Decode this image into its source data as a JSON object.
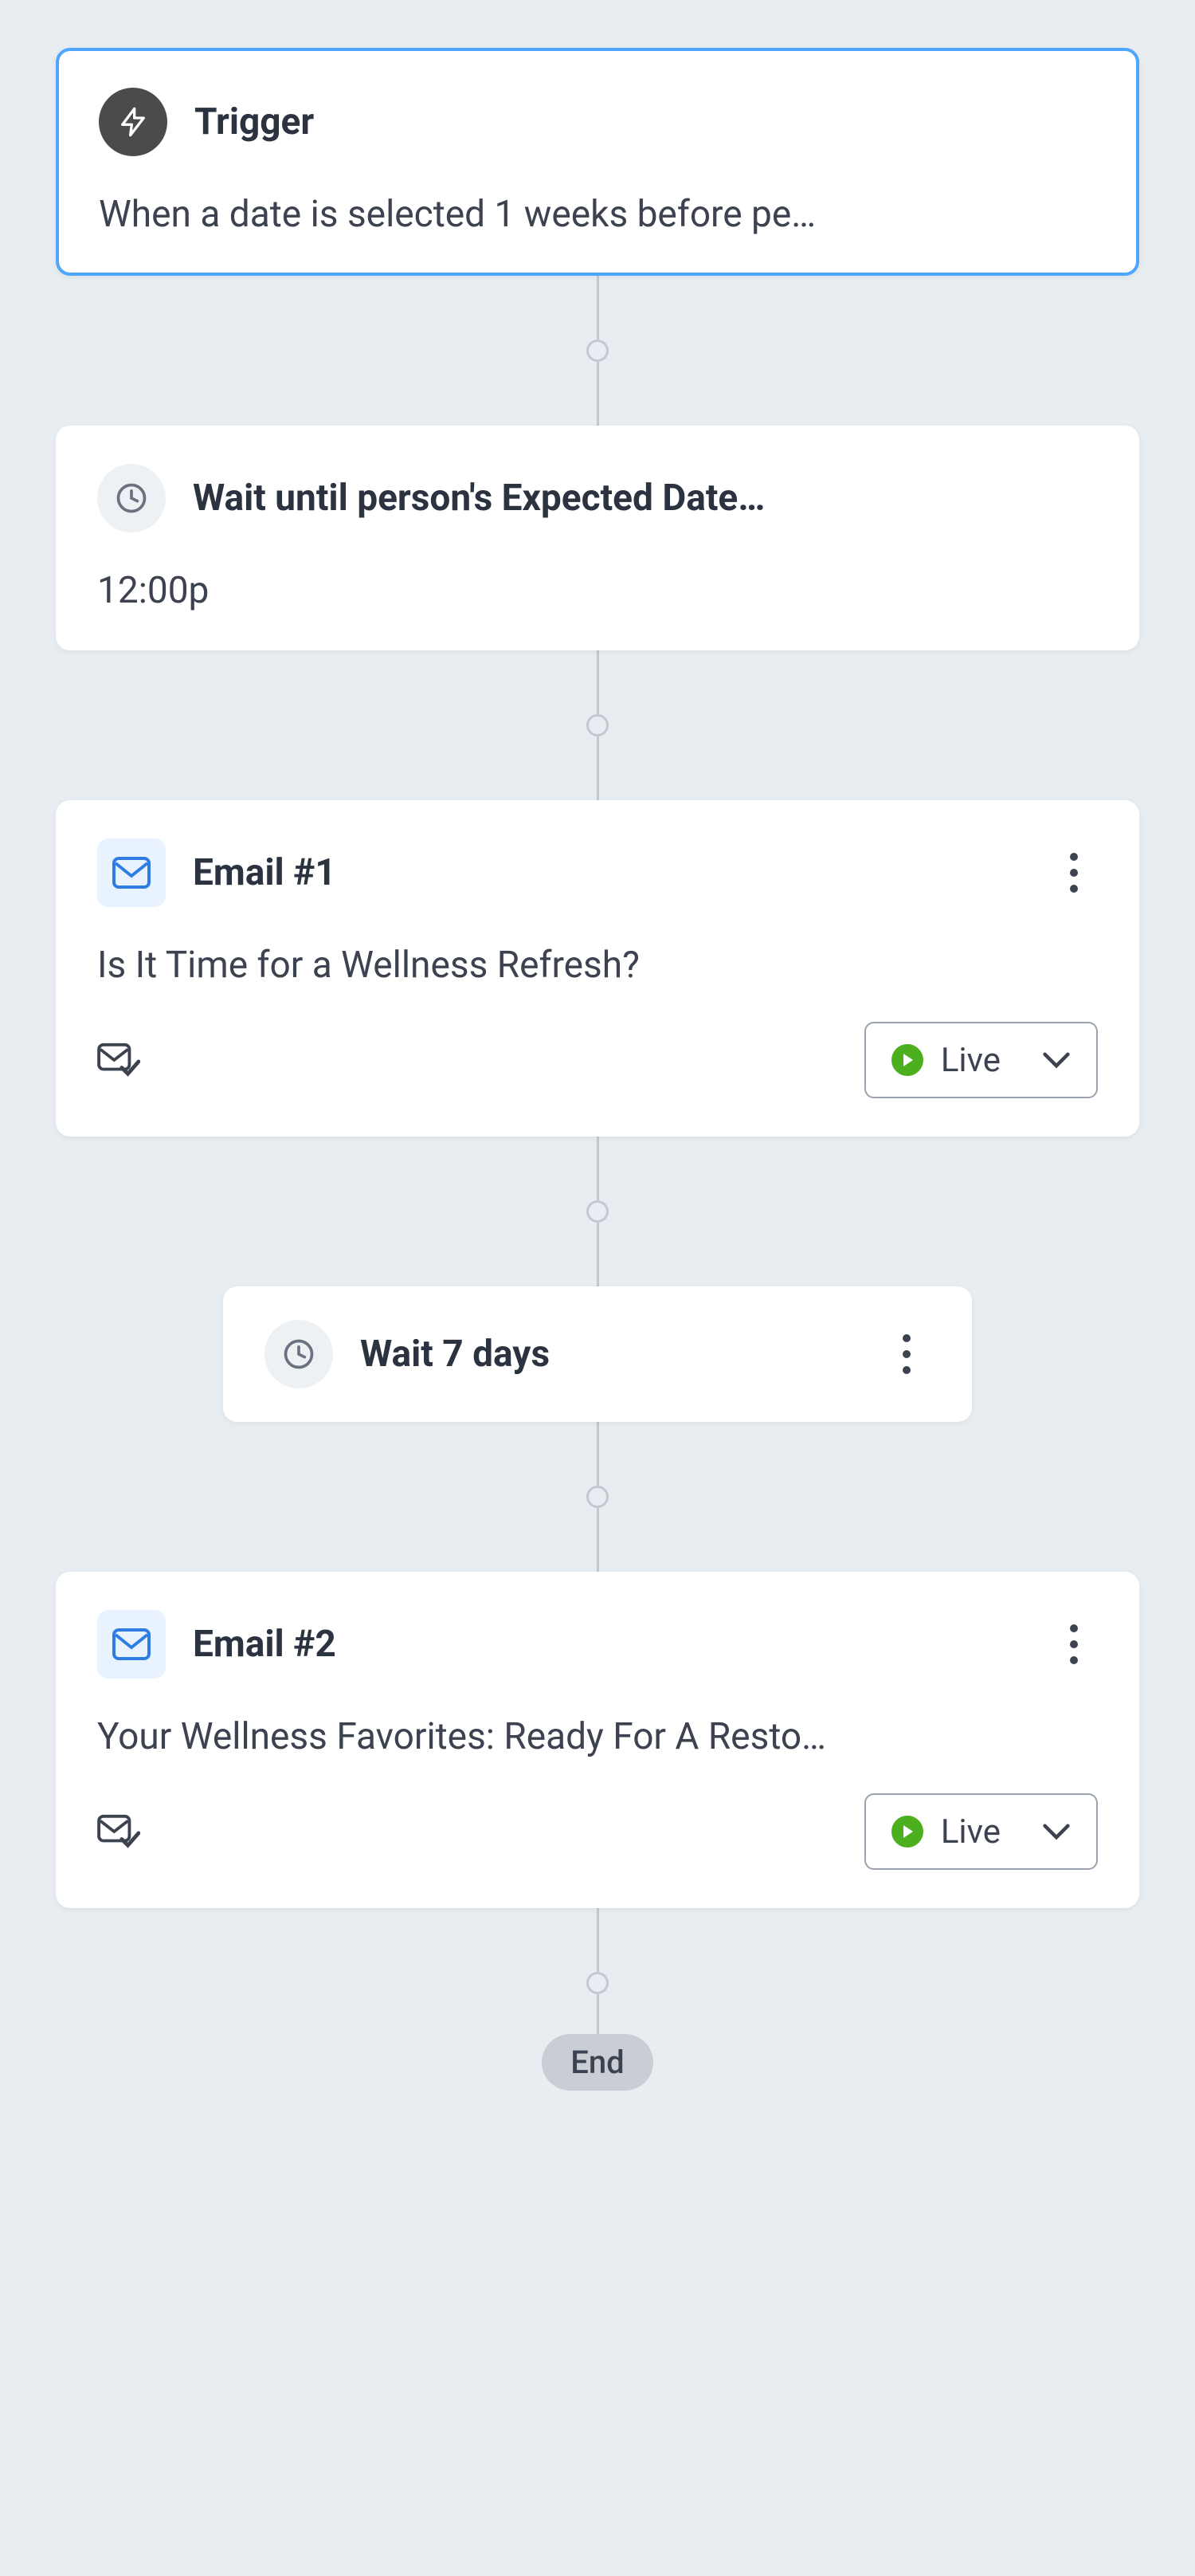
{
  "flow": {
    "trigger": {
      "title": "Trigger",
      "description": "When a date is selected 1 weeks before pe…"
    },
    "wait_until": {
      "title": "Wait until person's Expected Date…",
      "time": "12:00p"
    },
    "email1": {
      "title": "Email #1",
      "subject": "Is It Time for a Wellness Refresh?",
      "status": "Live"
    },
    "wait_7_days": {
      "title": "Wait 7 days"
    },
    "email2": {
      "title": "Email #2",
      "subject": "Your Wellness Favorites: Ready For A Resto…",
      "status": "Live"
    },
    "end": "End"
  }
}
